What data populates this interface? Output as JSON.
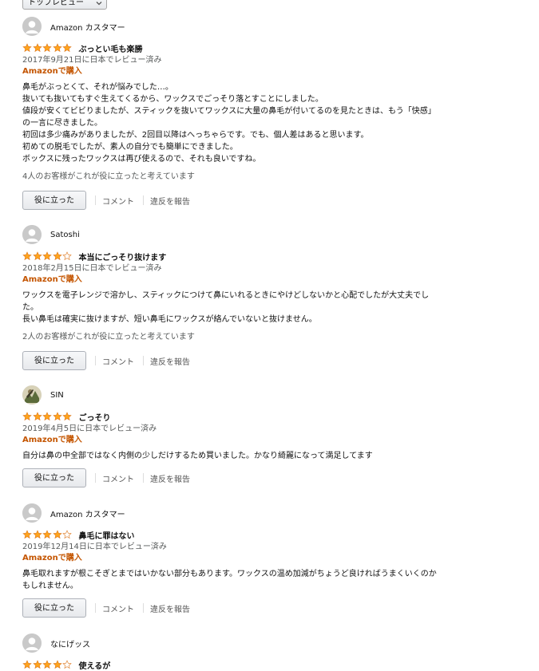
{
  "sort": {
    "selected": "トップレビュー"
  },
  "labels": {
    "helpful_button": "役に立った",
    "comment_link": "コメント",
    "report_link": "違反を報告",
    "verified": "Amazonで購入"
  },
  "colors": {
    "star": "#ffa41c",
    "star_outline": "#de7921",
    "verified": "#c45500"
  },
  "reviews": [
    {
      "profile_name": "Amazon カスタマー",
      "avatar": "default-avatar-icon",
      "rating": 5,
      "title": "ぶっとい毛も楽勝",
      "date": "2017年9月21日に日本でレビュー済み",
      "body": [
        "鼻毛がぶっとくて、それが悩みでした…。",
        "抜いても抜いてもすぐ生えてくるから、ワックスでごっそり落とすことにしました。",
        "値段が安くてビビりましたが、スティックを抜いてワックスに大量の鼻毛が付いてるのを見たときは、もう「快感」",
        "の一言に尽きました。",
        "初回は多少痛みがありましたが、2回目以降はへっちゃらです。でも、個人差はあると思います。",
        "初めての脱毛でしたが、素人の自分でも簡単にできました。",
        "ボックスに残ったワックスは再び使えるので、それも良いですね。"
      ],
      "helpful_count": "4人のお客様がこれが役に立ったと考えています"
    },
    {
      "profile_name": "Satoshi",
      "avatar": "default-avatar-icon",
      "rating": 4,
      "title": "本当にごっそり抜けます",
      "date": "2018年2月15日に日本でレビュー済み",
      "body": [
        "ワックスを電子レンジで溶かし、スティックにつけて鼻にいれるときにやけどしないかと心配でしたが大丈夫でし",
        "た。",
        "長い鼻毛は確実に抜けますが、短い鼻毛にワックスが絡んでいないと抜けません。"
      ],
      "helpful_count": "2人のお客様がこれが役に立ったと考えています"
    },
    {
      "profile_name": "SIN",
      "avatar": "photo-avatar-icon",
      "rating": 5,
      "title": "ごっそり",
      "date": "2019年4月5日に日本でレビュー済み",
      "body": [
        "自分は鼻の中全部ではなく内側の少しだけするため買いました。かなり綺麗になって満足してます"
      ],
      "helpful_count": ""
    },
    {
      "profile_name": "Amazon カスタマー",
      "avatar": "default-avatar-icon",
      "rating": 4,
      "title": "鼻毛に罪はない",
      "date": "2019年12月14日に日本でレビュー済み",
      "body": [
        "鼻毛取れますが根こそぎとまではいかない部分もあります。ワックスの温め加減がちょうど良ければうまくいくのか",
        "もしれません。"
      ],
      "helpful_count": ""
    },
    {
      "profile_name": "なにげッス",
      "avatar": "default-avatar-icon",
      "rating": 4,
      "title": "使えるが",
      "date": "",
      "body": [],
      "helpful_count": ""
    }
  ]
}
